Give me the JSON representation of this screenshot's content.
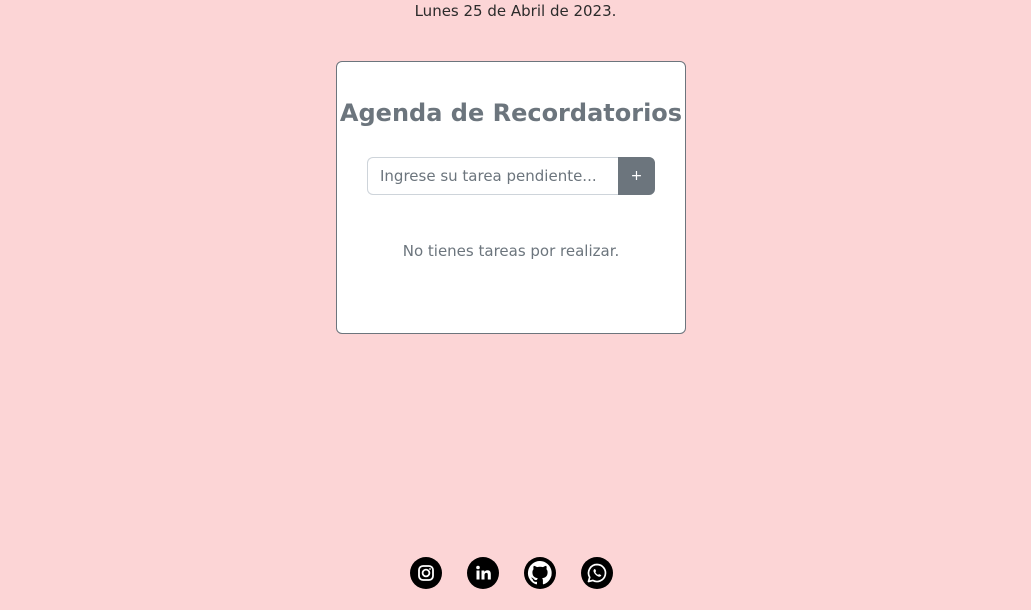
{
  "header": {
    "date": "Lunes 25 de Abril de 2023."
  },
  "card": {
    "title": "Agenda de Recordatorios",
    "input_placeholder": "Ingrese su tarea pendiente...",
    "add_button_label": "+",
    "empty_message": "No tienes tareas por realizar."
  },
  "social": [
    {
      "icon": "instagram-icon"
    },
    {
      "icon": "linkedin-icon"
    },
    {
      "icon": "github-icon"
    },
    {
      "icon": "whatsapp-icon"
    }
  ],
  "colors": {
    "background": "#fcd5d6",
    "accent": "#6c757d"
  }
}
